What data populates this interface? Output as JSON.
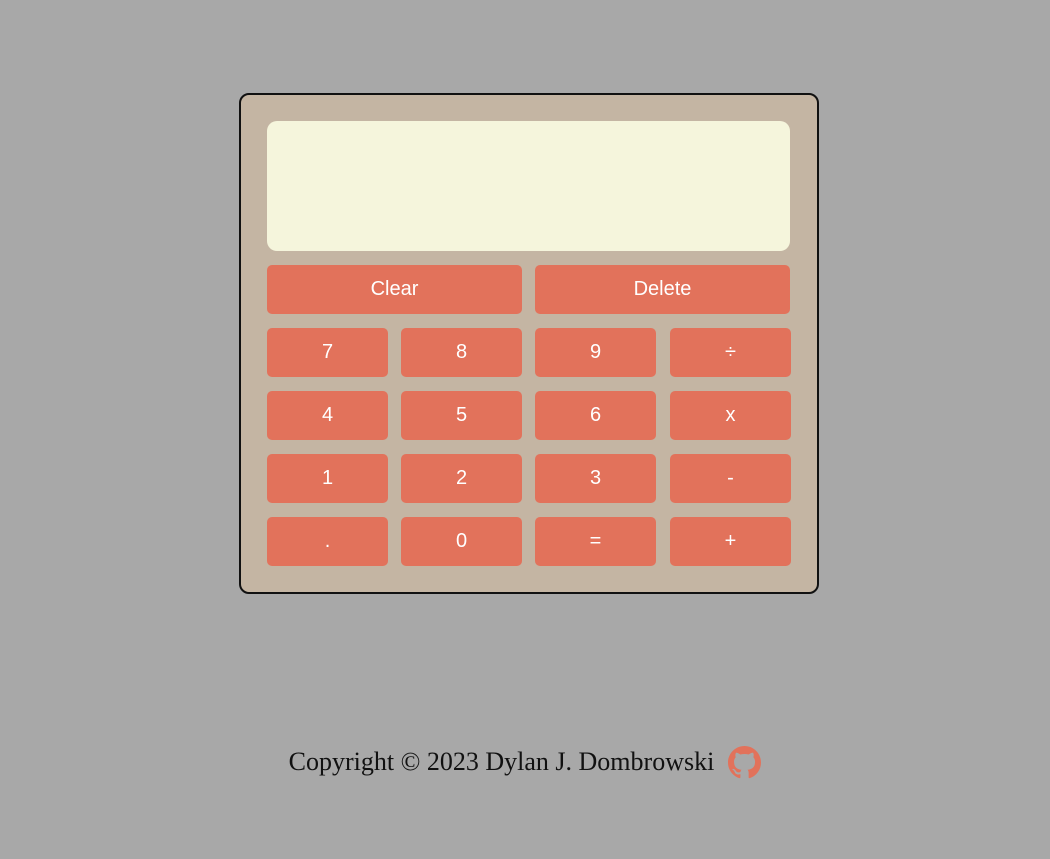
{
  "display": {
    "previous_operand": "",
    "current_operand": ""
  },
  "buttons": {
    "clear": "Clear",
    "delete": "Delete",
    "seven": "7",
    "eight": "8",
    "nine": "9",
    "divide": "÷",
    "four": "4",
    "five": "5",
    "six": "6",
    "multiply": "x",
    "one": "1",
    "two": "2",
    "three": "3",
    "subtract": "-",
    "decimal": ".",
    "zero": "0",
    "equals": "=",
    "add": "+"
  },
  "footer": {
    "copyright": "Copyright © 2023 Dylan J. Dombrowski",
    "github_icon": "github-icon"
  },
  "colors": {
    "page_background": "#a8a8a8",
    "calculator_body": "#c4b5a3",
    "display_background": "#f5f5dc",
    "button_background": "#e2725b",
    "button_text": "#ffffff",
    "github_icon": "#e2725b"
  }
}
